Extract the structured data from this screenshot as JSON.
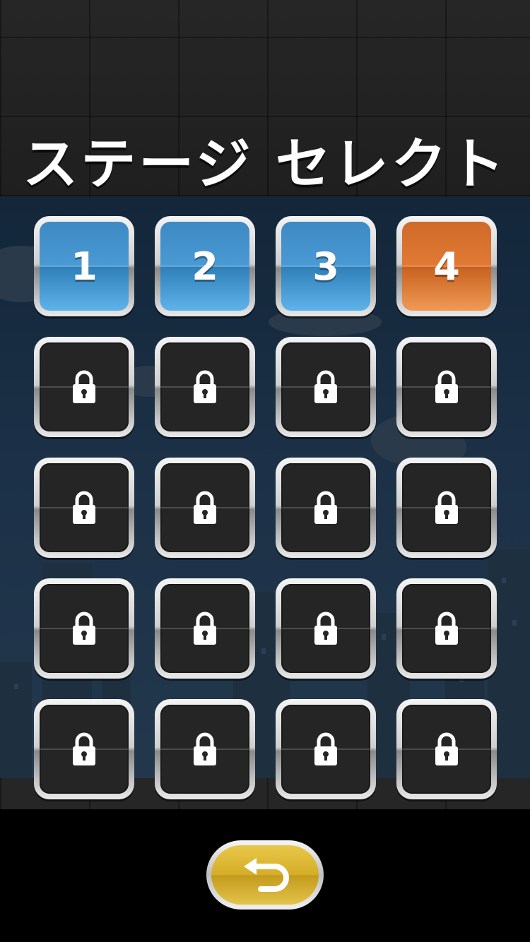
{
  "title": "ステージ セレクト",
  "stages": [
    {
      "label": "1",
      "state": "open"
    },
    {
      "label": "2",
      "state": "open"
    },
    {
      "label": "3",
      "state": "open"
    },
    {
      "label": "4",
      "state": "current"
    },
    {
      "label": "",
      "state": "locked"
    },
    {
      "label": "",
      "state": "locked"
    },
    {
      "label": "",
      "state": "locked"
    },
    {
      "label": "",
      "state": "locked"
    },
    {
      "label": "",
      "state": "locked"
    },
    {
      "label": "",
      "state": "locked"
    },
    {
      "label": "",
      "state": "locked"
    },
    {
      "label": "",
      "state": "locked"
    },
    {
      "label": "",
      "state": "locked"
    },
    {
      "label": "",
      "state": "locked"
    },
    {
      "label": "",
      "state": "locked"
    },
    {
      "label": "",
      "state": "locked"
    },
    {
      "label": "",
      "state": "locked"
    },
    {
      "label": "",
      "state": "locked"
    },
    {
      "label": "",
      "state": "locked"
    },
    {
      "label": "",
      "state": "locked"
    }
  ],
  "icons": {
    "locked": "lock-icon",
    "back": "return-arrow-icon"
  },
  "colors": {
    "open": "#4a9ad4",
    "current": "#e07a34",
    "locked": "#252525",
    "back": "#d5ad28"
  }
}
